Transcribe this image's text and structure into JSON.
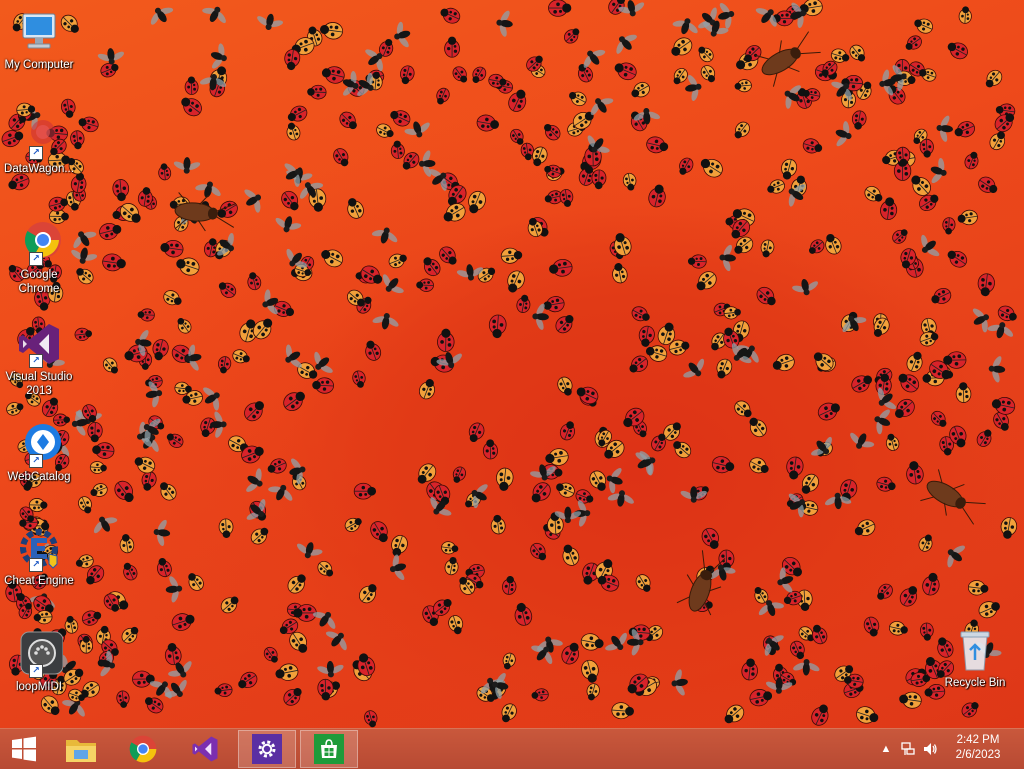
{
  "desktop": {
    "icons": [
      {
        "label": "My Computer",
        "icon": "computer-icon"
      },
      {
        "label": "DataWagon...",
        "icon": "datawagon-icon"
      },
      {
        "label": "Google Chrome",
        "icon": "chrome-icon"
      },
      {
        "label": "Visual Studio 2013",
        "icon": "visual-studio-icon"
      },
      {
        "label": "WebCatalog",
        "icon": "webcatalog-icon"
      },
      {
        "label": "Cheat Engine",
        "icon": "cheat-engine-icon"
      },
      {
        "label": "loopMIDI",
        "icon": "loopmidi-icon"
      },
      {
        "label": "Recycle Bin",
        "icon": "recycle-bin-icon"
      }
    ],
    "wallpaper": {
      "description_colors": {
        "base": "#f0461a",
        "swirl": "#dd3216"
      }
    }
  },
  "taskbar": {
    "start": {
      "icon": "windows-start-icon"
    },
    "pinned": [
      {
        "name": "File Explorer",
        "icon": "file-explorer-icon"
      },
      {
        "name": "Google Chrome",
        "icon": "chrome-icon"
      },
      {
        "name": "Visual Studio",
        "icon": "visual-studio-icon"
      },
      {
        "name": "Settings",
        "icon": "settings-gear-icon",
        "active": true
      },
      {
        "name": "Store",
        "icon": "store-icon",
        "active": true
      }
    ],
    "tray": {
      "show_hidden_icon": "chevron-up-icon",
      "network_icon": "network-icon",
      "volume_icon": "volume-icon",
      "time": "2:42 PM",
      "date": "2/6/2023"
    },
    "colors": {
      "bar": "#bd4d35",
      "accent": "#6b2fa8",
      "store": "#1e9b3a"
    }
  }
}
